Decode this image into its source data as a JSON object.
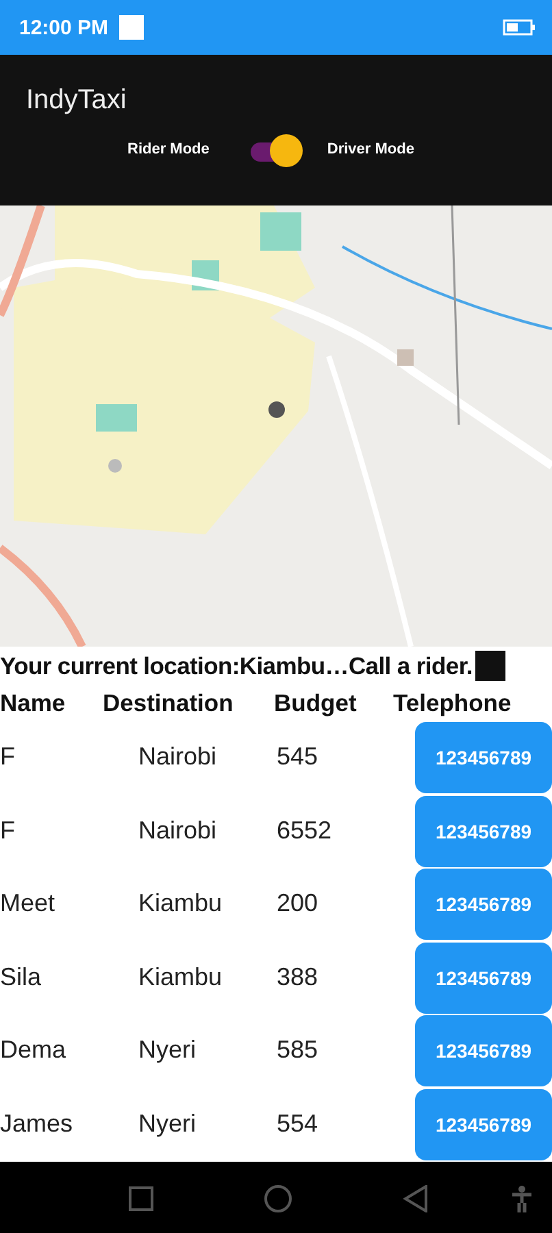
{
  "status_bar": {
    "time": "12:00 PM"
  },
  "app_bar": {
    "title": "IndyTaxi",
    "mode_switch": {
      "left_label": "Rider Mode",
      "right_label": "Driver Mode",
      "on": true
    }
  },
  "location_text": "Your current location:Kiambu…Call a rider.",
  "table": {
    "columns": [
      "Name",
      "Destination",
      "Budget",
      "Telephone"
    ],
    "rows": [
      {
        "name": "F",
        "destination": "Nairobi",
        "budget": "545",
        "telephone": "123456789"
      },
      {
        "name": "F",
        "destination": "Nairobi",
        "budget": "6552",
        "telephone": "123456789"
      },
      {
        "name": "Meet",
        "destination": "Kiambu",
        "budget": "200",
        "telephone": "123456789"
      },
      {
        "name": "Sila",
        "destination": "Kiambu",
        "budget": "388",
        "telephone": "123456789"
      },
      {
        "name": "Dema",
        "destination": "Nyeri",
        "budget": "585",
        "telephone": "123456789"
      },
      {
        "name": "James",
        "destination": "Nyeri",
        "budget": "554",
        "telephone": "123456789"
      }
    ]
  }
}
